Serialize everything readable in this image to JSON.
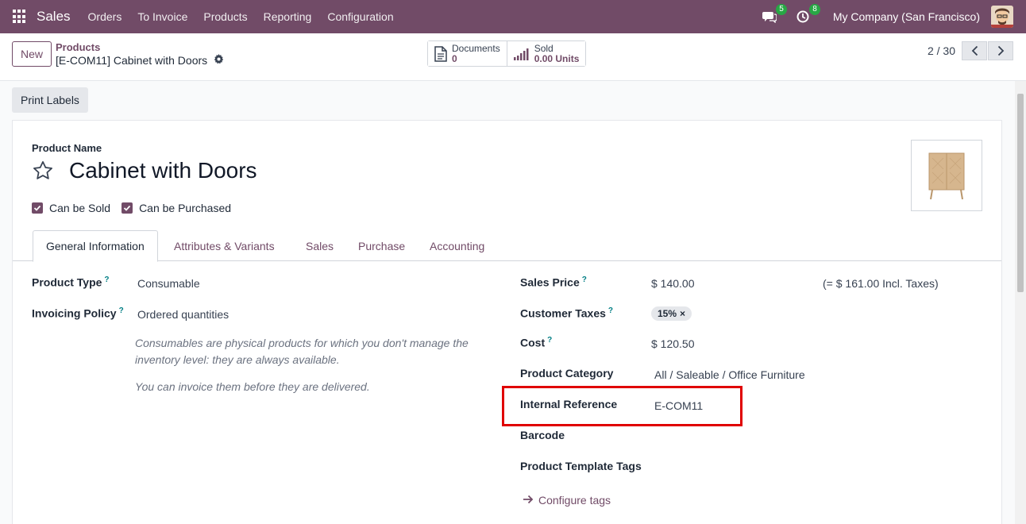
{
  "navbar": {
    "app_name": "Sales",
    "menu": [
      "Orders",
      "To Invoice",
      "Products",
      "Reporting",
      "Configuration"
    ],
    "messages_count": "5",
    "activities_count": "8",
    "company": "My Company (San Francisco)"
  },
  "control": {
    "new_label": "New",
    "breadcrumb_parent": "Products",
    "breadcrumb_current": "[E-COM11] Cabinet with Doors",
    "smart_buttons": [
      {
        "label": "Documents",
        "value": "0"
      },
      {
        "label": "Sold",
        "value": "0.00 Units"
      }
    ],
    "pager": "2 / 30"
  },
  "actions": {
    "print_labels": "Print Labels"
  },
  "form": {
    "product_name_label": "Product Name",
    "product_name": "Cabinet with Doors",
    "can_be_sold": "Can be Sold",
    "can_be_purchased": "Can be Purchased",
    "tabs": [
      "General Information",
      "Attributes & Variants",
      "Sales",
      "Purchase",
      "Accounting"
    ],
    "left": {
      "product_type_label": "Product Type",
      "product_type": "Consumable",
      "invoicing_policy_label": "Invoicing Policy",
      "invoicing_policy": "Ordered quantities",
      "help1_line1": "Consumables are physical products for which you don't manage the",
      "help1_line2": "inventory level: they are always available.",
      "help2": "You can invoice them before they are delivered."
    },
    "right": {
      "sales_price_label": "Sales Price",
      "sales_price": "$ 140.00",
      "incl_taxes": "(= $ 161.00 Incl. Taxes)",
      "customer_taxes_label": "Customer Taxes",
      "tax_tag": "15%",
      "cost_label": "Cost",
      "cost": "$ 120.50",
      "category_label": "Product Category",
      "category": "All / Saleable / Office Furniture",
      "internal_ref_label": "Internal Reference",
      "internal_ref": "E-COM11",
      "barcode_label": "Barcode",
      "tags_label": "Product Template Tags",
      "configure_tags": "Configure tags"
    },
    "help_mark": "?"
  },
  "colors": {
    "brand": "#714b67",
    "highlight": "#e00000"
  }
}
